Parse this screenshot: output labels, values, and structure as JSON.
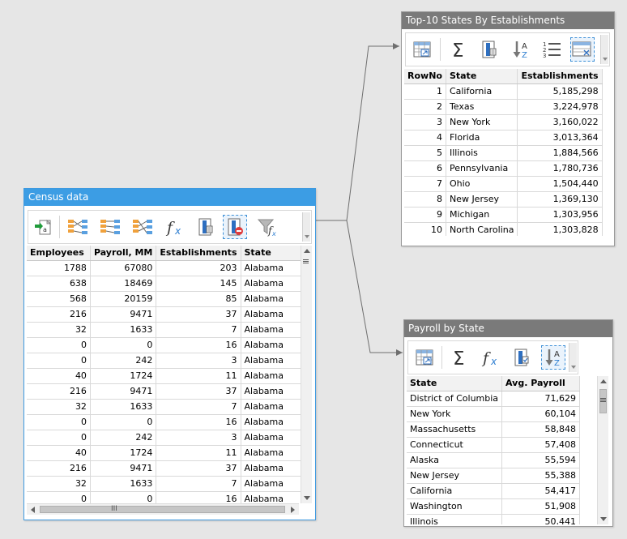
{
  "colors": {
    "active_title": "#3c9de4",
    "inactive_title": "#7a7a7a",
    "canvas": "#e6e6e6",
    "selected_tool": "#3c8fd6"
  },
  "census": {
    "title": "Census data",
    "columns": [
      "Employees",
      "Payroll, MM",
      "Establishments",
      "State"
    ],
    "rows": [
      [
        "1788",
        "67080",
        "203",
        "Alabama"
      ],
      [
        "638",
        "18469",
        "145",
        "Alabama"
      ],
      [
        "568",
        "20159",
        "85",
        "Alabama"
      ],
      [
        "216",
        "9471",
        "37",
        "Alabama"
      ],
      [
        "32",
        "1633",
        "7",
        "Alabama"
      ],
      [
        "0",
        "0",
        "16",
        "Alabama"
      ],
      [
        "0",
        "242",
        "3",
        "Alabama"
      ],
      [
        "40",
        "1724",
        "11",
        "Alabama"
      ],
      [
        "216",
        "9471",
        "37",
        "Alabama"
      ],
      [
        "32",
        "1633",
        "7",
        "Alabama"
      ],
      [
        "0",
        "0",
        "16",
        "Alabama"
      ],
      [
        "0",
        "242",
        "3",
        "Alabama"
      ],
      [
        "40",
        "1724",
        "11",
        "Alabama"
      ],
      [
        "216",
        "9471",
        "37",
        "Alabama"
      ],
      [
        "32",
        "1633",
        "7",
        "Alabama"
      ],
      [
        "0",
        "0",
        "16",
        "Alabama"
      ]
    ],
    "tools": [
      "add-column-icon",
      "merge-left-icon",
      "merge-inner-icon",
      "merge-right-icon",
      "formula-icon",
      "select-columns-icon",
      "remove-columns-icon",
      "filter-formula-icon"
    ],
    "selected_tool": "remove-columns-icon",
    "hscroll_grip": "III"
  },
  "top10": {
    "title": "Top-10 States By Establishments",
    "columns": [
      "RowNo",
      "State",
      "Establishments"
    ],
    "rows": [
      [
        "1",
        "California",
        "5,185,298"
      ],
      [
        "2",
        "Texas",
        "3,224,978"
      ],
      [
        "3",
        "New York",
        "3,160,022"
      ],
      [
        "4",
        "Florida",
        "3,013,364"
      ],
      [
        "5",
        "Illinois",
        "1,884,566"
      ],
      [
        "6",
        "Pennsylvania",
        "1,780,736"
      ],
      [
        "7",
        "Ohio",
        "1,504,440"
      ],
      [
        "8",
        "New Jersey",
        "1,369,130"
      ],
      [
        "9",
        "Michigan",
        "1,303,956"
      ],
      [
        "10",
        "North Carolina",
        "1,303,828"
      ]
    ],
    "tools": [
      "select-columns-icon",
      "aggregate-sigma-icon",
      "select-columns-icon",
      "sort-az-icon",
      "row-numbers-icon",
      "top-rows-icon"
    ],
    "selected_tool": "top-rows-icon"
  },
  "payroll": {
    "title": "Payroll by State",
    "columns": [
      "State",
      "Avg. Payroll"
    ],
    "rows": [
      [
        "District of Columbia",
        "71,629"
      ],
      [
        "New York",
        "60,104"
      ],
      [
        "Massachusetts",
        "58,848"
      ],
      [
        "Connecticut",
        "57,408"
      ],
      [
        "Alaska",
        "55,594"
      ],
      [
        "New Jersey",
        "55,388"
      ],
      [
        "California",
        "54,417"
      ],
      [
        "Washington",
        "51,908"
      ],
      [
        "Illinois",
        "50,441"
      ]
    ],
    "tools": [
      "select-columns-icon",
      "aggregate-sigma-icon",
      "formula-icon",
      "select-columns-icon",
      "sort-az-icon"
    ],
    "selected_tool": "sort-az-icon"
  }
}
